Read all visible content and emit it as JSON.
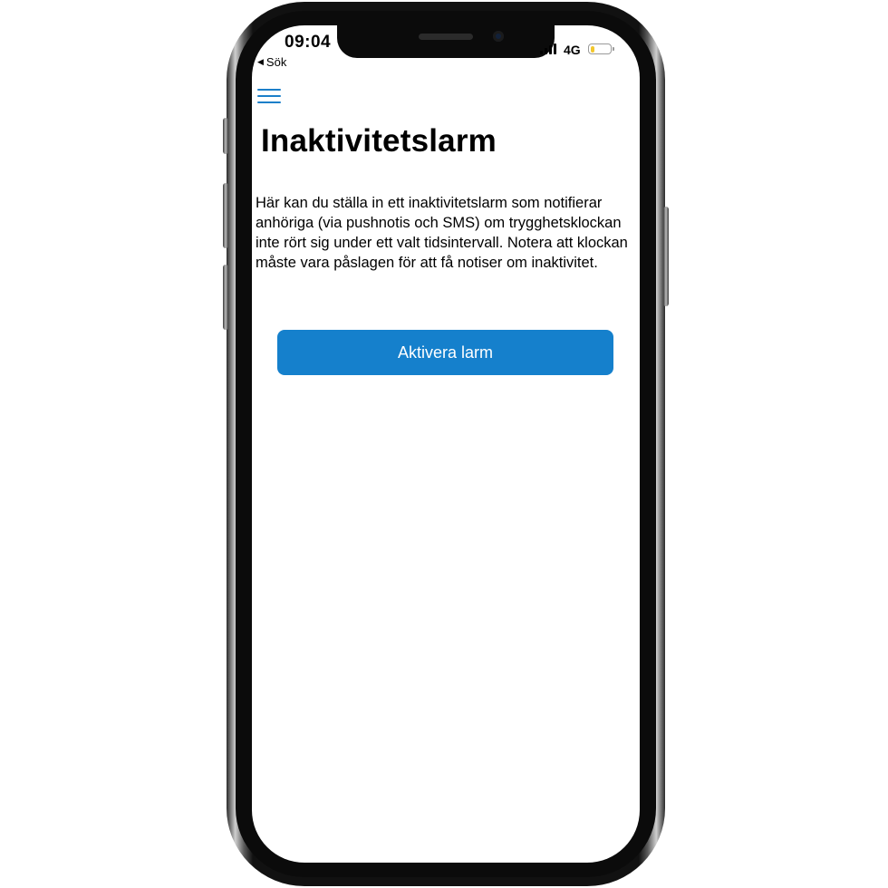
{
  "colors": {
    "accent": "#1580cc",
    "menu_icon": "#1b7fc9",
    "battery_level": "#f2c72e",
    "text": "#000000",
    "screen_bg": "#ffffff"
  },
  "status_bar": {
    "time": "09:04",
    "back_label": "Sök",
    "back_icon": "back-triangle-icon",
    "network": "4G",
    "signal_icon": "signal-bars-icon",
    "battery_icon": "battery-icon",
    "battery_level": 0.2
  },
  "header": {
    "menu_icon": "hamburger-menu-icon"
  },
  "main": {
    "title": "Inaktivitetslarm",
    "description": "Här kan du ställa in ett inaktivitetslarm som notifierar anhöriga (via pushnotis och SMS) om trygghetsklockan inte rört sig under ett valt tidsintervall. Notera att klockan måste vara påslagen för att få notiser om inaktivitet.",
    "activate_button_label": "Aktivera larm"
  }
}
